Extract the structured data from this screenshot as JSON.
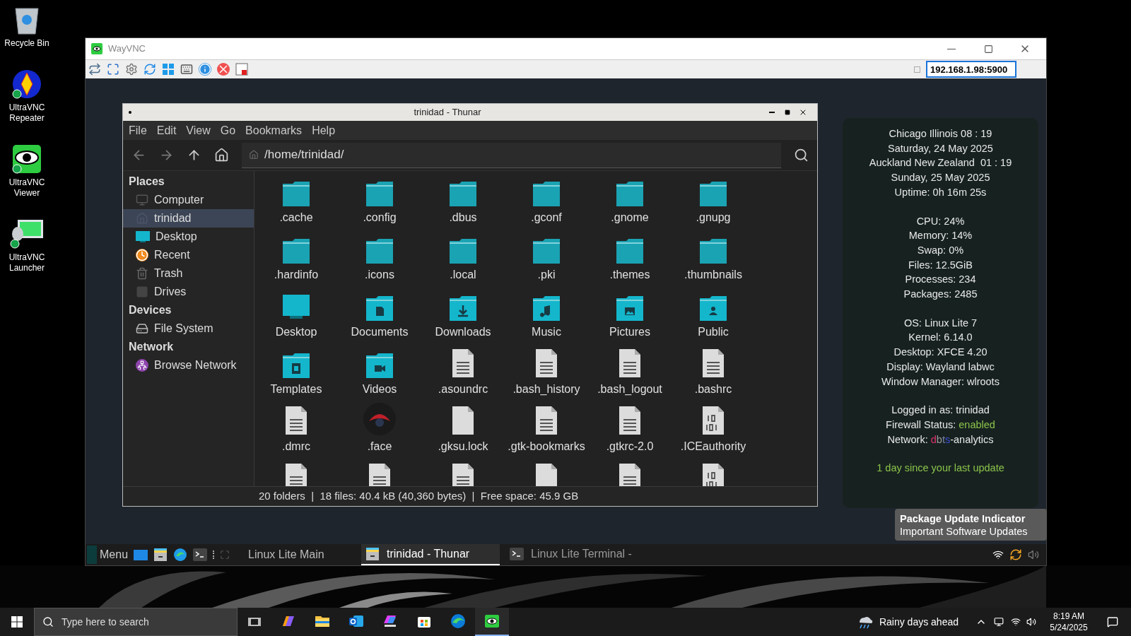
{
  "desktop_icons": [
    {
      "label": "Recycle Bin",
      "kind": "recycle"
    },
    {
      "label": "UltraVNC Repeater",
      "kind": "repeater"
    },
    {
      "label": "UltraVNC Viewer",
      "kind": "viewer"
    },
    {
      "label": "UltraVNC Launcher",
      "kind": "launcher"
    }
  ],
  "vnc_window": {
    "title": "WayVNC",
    "address": "192.168.1.98:5900",
    "address_check": false
  },
  "thunar": {
    "title": "trinidad - Thunar",
    "menu": [
      "File",
      "Edit",
      "View",
      "Go",
      "Bookmarks",
      "Help"
    ],
    "path": "/home/trinidad/",
    "sidebar": [
      {
        "heading": "Places",
        "items": [
          {
            "label": "Computer",
            "kind": "computer",
            "selected": false
          },
          {
            "label": "trinidad",
            "kind": "home",
            "selected": true
          },
          {
            "label": "Desktop",
            "kind": "desktop",
            "selected": false
          },
          {
            "label": "Recent",
            "kind": "recent",
            "selected": false
          },
          {
            "label": "Trash",
            "kind": "trash",
            "selected": false
          },
          {
            "label": "Drives",
            "kind": "drives",
            "selected": false
          }
        ]
      },
      {
        "heading": "Devices",
        "items": [
          {
            "label": "File System",
            "kind": "filesystem",
            "selected": false
          }
        ]
      },
      {
        "heading": "Network",
        "items": [
          {
            "label": "Browse Network",
            "kind": "network",
            "selected": false
          }
        ]
      }
    ],
    "files": [
      {
        "name": ".cache",
        "kind": "folder"
      },
      {
        "name": ".config",
        "kind": "folder"
      },
      {
        "name": ".dbus",
        "kind": "folder"
      },
      {
        "name": ".gconf",
        "kind": "folder"
      },
      {
        "name": ".gnome",
        "kind": "folder"
      },
      {
        "name": ".gnupg",
        "kind": "folder"
      },
      {
        "name": ".hardinfo",
        "kind": "folder"
      },
      {
        "name": ".icons",
        "kind": "folder"
      },
      {
        "name": ".local",
        "kind": "folder"
      },
      {
        "name": ".pki",
        "kind": "folder"
      },
      {
        "name": ".themes",
        "kind": "folder"
      },
      {
        "name": ".thumbnails",
        "kind": "folder"
      },
      {
        "name": "Desktop",
        "kind": "desktop"
      },
      {
        "name": "Documents",
        "kind": "documents"
      },
      {
        "name": "Downloads",
        "kind": "downloads"
      },
      {
        "name": "Music",
        "kind": "music"
      },
      {
        "name": "Pictures",
        "kind": "pictures"
      },
      {
        "name": "Public",
        "kind": "public"
      },
      {
        "name": "Templates",
        "kind": "templates"
      },
      {
        "name": "Videos",
        "kind": "videos"
      },
      {
        "name": ".asoundrc",
        "kind": "text"
      },
      {
        "name": ".bash_history",
        "kind": "text"
      },
      {
        "name": ".bash_logout",
        "kind": "text"
      },
      {
        "name": ".bashrc",
        "kind": "text"
      },
      {
        "name": ".dmrc",
        "kind": "text"
      },
      {
        "name": ".face"
      },
      {
        "name": ".gksu.lock",
        "kind": "blank"
      },
      {
        "name": ".gtk-bookmarks",
        "kind": "text"
      },
      {
        "name": ".gtkrc-2.0",
        "kind": "text"
      },
      {
        "name": ".ICEauthority",
        "kind": "binary"
      },
      {
        "kind": "text"
      },
      {
        "kind": "text"
      },
      {
        "kind": "text"
      },
      {
        "kind": "blank"
      },
      {
        "kind": "text"
      },
      {
        "kind": "binary"
      }
    ],
    "status": "20 folders  |  18 files: 40.4 kB (40,360 bytes)  |  Free space: 45.9 GB"
  },
  "conky": {
    "groups": [
      [
        [
          {
            "text": "Chicago Illinois 08 : 19",
            "color": "#e8e8e8"
          }
        ],
        [
          {
            "text": "Saturday, 24 May 2025",
            "color": "#e8e8e8"
          }
        ],
        [
          {
            "text": "Auckland New Zealand  01 : 19",
            "color": "#e8e8e8"
          }
        ],
        [
          {
            "text": "Sunday, 25 May 2025",
            "color": "#e8e8e8"
          }
        ],
        [
          {
            "text": "Uptime: 0h 16m 25s",
            "color": "#e8e8e8"
          }
        ]
      ],
      [
        [
          {
            "text": "CPU: 24%",
            "color": "#e8e8e8"
          }
        ],
        [
          {
            "text": "Memory: 14%",
            "color": "#e8e8e8"
          }
        ],
        [
          {
            "text": "Swap: 0%",
            "color": "#e8e8e8"
          }
        ],
        [
          {
            "text": "Files: 12.5GiB",
            "color": "#e8e8e8"
          }
        ],
        [
          {
            "text": "Processes: 234",
            "color": "#e8e8e8"
          }
        ],
        [
          {
            "text": "Packages: 2485",
            "color": "#e8e8e8"
          }
        ]
      ],
      [
        [
          {
            "text": "OS: Linux Lite 7",
            "color": "#e8e8e8"
          }
        ],
        [
          {
            "text": "Kernel: 6.14.0",
            "color": "#e8e8e8"
          }
        ],
        [
          {
            "text": "Desktop: XFCE 4.20",
            "color": "#e8e8e8"
          }
        ],
        [
          {
            "text": "Display: Wayland labwc",
            "color": "#e8e8e8"
          }
        ],
        [
          {
            "text": "Window Manager: wlroots",
            "color": "#e8e8e8"
          }
        ]
      ],
      [
        [
          {
            "text": "Logged in as: trinidad",
            "color": "#e8e8e8"
          }
        ],
        [
          {
            "text": "Firewall Status: ",
            "color": "#e8e8e8"
          },
          {
            "text": "enabled",
            "color": "#8bc34a"
          }
        ],
        [
          {
            "text": "Network: ",
            "color": "#e8e8e8"
          },
          {
            "text": "d",
            "color": "#e0306e"
          },
          {
            "text": "b",
            "color": "#9a9a9a"
          },
          {
            "text": "t",
            "color": "#7a86a8"
          },
          {
            "text": "s",
            "color": "#3c4fd8"
          },
          {
            "text": "-analytics",
            "color": "#e8e8e8"
          }
        ]
      ],
      [
        [
          {
            "text": "1 day since your last update",
            "color": "#8bc34a"
          }
        ]
      ]
    ]
  },
  "tooltip": {
    "title": "Package Update Indicator",
    "text": "Important Software Updates"
  },
  "linux_taskbar": {
    "menu": "Menu",
    "workspace": "Linux Lite Main",
    "tasks": [
      {
        "label": "trinidad - Thunar",
        "kind": "filemanager",
        "selected": true
      },
      {
        "label": "Linux Lite Terminal -",
        "kind": "terminal",
        "selected": false
      }
    ]
  },
  "windows_taskbar": {
    "search_placeholder": "Type here to search",
    "apps": [
      {
        "kind": "copilot",
        "selected": false
      },
      {
        "kind": "explorer",
        "selected": false
      },
      {
        "kind": "outlook",
        "selected": false
      },
      {
        "kind": "m365",
        "selected": false
      },
      {
        "kind": "store",
        "selected": false
      },
      {
        "kind": "edge",
        "selected": false
      },
      {
        "kind": "vnc",
        "selected": true
      }
    ],
    "weather": "Rainy days ahead",
    "time": "8:19 AM",
    "date": "5/24/2025"
  }
}
